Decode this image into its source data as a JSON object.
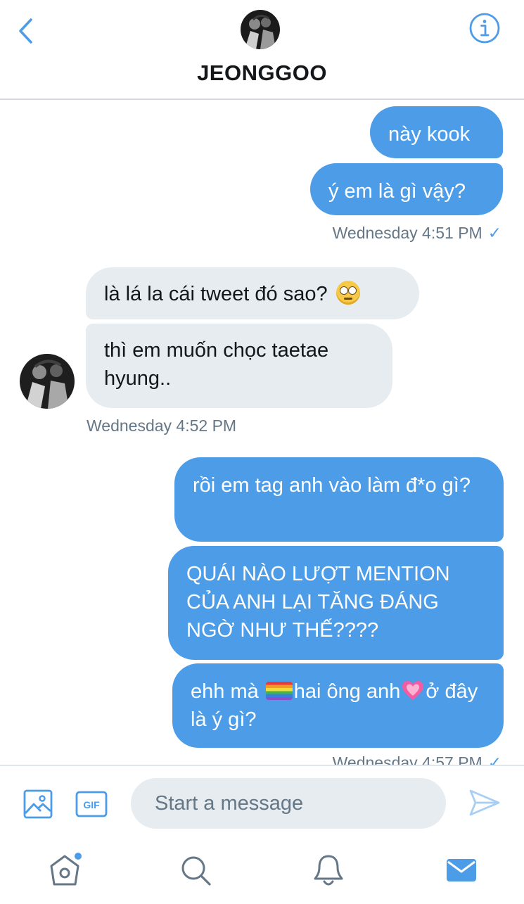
{
  "header": {
    "title": "JEONGGOO"
  },
  "messages": [
    {
      "side": "sent",
      "text": "này kook"
    },
    {
      "side": "sent",
      "text": "ý em là gì vậy?"
    },
    {
      "side": "received",
      "text": "là lá la cái tweet đó sao?"
    },
    {
      "side": "received",
      "text": "thì em muốn chọc taetae hyung.."
    },
    {
      "side": "sent",
      "text": "rồi em tag anh vào làm đ*o gì?"
    },
    {
      "side": "sent",
      "text": "QUÁI NÀO LƯỢT MENTION CỦA ANH LẠI TĂNG ĐÁNG NGỜ NHƯ THẾ????"
    },
    {
      "side": "sent",
      "text_before": "ehh mà",
      "text_middle": "hai ông anh",
      "text_after": "ở đây là ý gì?"
    }
  ],
  "timestamps": {
    "t1": "Wednesday 4:51 PM",
    "t2": "Wednesday 4:52 PM",
    "t3": "Wednesday 4:57 PM"
  },
  "emojis": {
    "face": "face-with-rolling-eyes",
    "flag": "rainbow-flag",
    "heart": "growing-heart"
  },
  "composer": {
    "placeholder": "Start a message",
    "gif_label": "GIF"
  },
  "tabs": [
    "home",
    "search",
    "notifications",
    "messages"
  ],
  "colors": {
    "accent": "#4c9ce8",
    "sent_bubble": "#4c9ce8",
    "received_bubble": "#e6ecf0",
    "timestamp": "#657786"
  }
}
